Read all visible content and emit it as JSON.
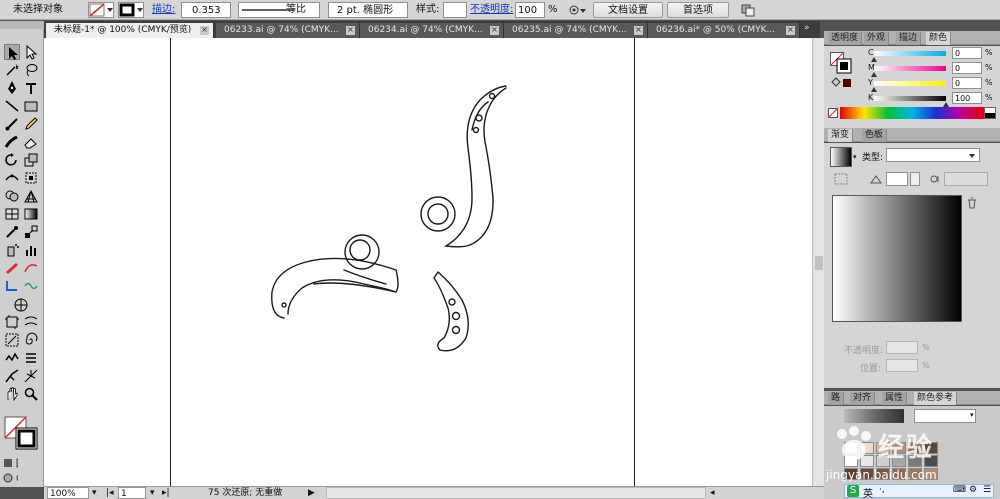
{
  "control_bar": {
    "selection_status": "未选择对象",
    "stroke_label": "描边:",
    "stroke_value": "0.353",
    "profile_label": "等比",
    "brush_label": "2 pt. 椭圆形",
    "style_label": "样式:",
    "opacity_label": "不透明度:",
    "opacity_value": "100",
    "opacity_unit": "%",
    "doc_setup_button": "文档设置",
    "preferences_button": "首选项"
  },
  "tabs": [
    {
      "label": "未标题-1* @ 100% (CMYK/预览)",
      "active": true
    },
    {
      "label": "06233.ai @ 74% (CMYK...",
      "active": false
    },
    {
      "label": "06234.ai @ 74% (CMYK...",
      "active": false
    },
    {
      "label": "06235.ai @ 74% (CMYK...",
      "active": false
    },
    {
      "label": "06236.ai* @ 50% (CMYK...",
      "active": false
    }
  ],
  "status_bar": {
    "zoom": "100%",
    "page": "1",
    "undo_text": "75 次还原; 无重做"
  },
  "color_panel": {
    "tabs": [
      "透明度",
      "外观",
      "描边",
      "颜色"
    ],
    "active_tab": "颜色",
    "channels": [
      {
        "label": "C",
        "value": "0",
        "unit": "%",
        "level": 0
      },
      {
        "label": "M",
        "value": "0",
        "unit": "%",
        "level": 0
      },
      {
        "label": "Y",
        "value": "0",
        "unit": "%",
        "level": 0
      },
      {
        "label": "K",
        "value": "100",
        "unit": "%",
        "level": 1
      }
    ],
    "colors": {
      "c": "#00aeef",
      "m": "#ec008c",
      "y": "#fff200",
      "k": "#000000"
    }
  },
  "gradient_panel": {
    "tabs": [
      "渐变",
      "色板"
    ],
    "active_tab": "渐变",
    "type_label": "类型:",
    "opacity_label": "不透明度:",
    "location_label": "位置:",
    "opacity_unit": "%",
    "location_unit": "%"
  },
  "guide_panel": {
    "tabs": [
      "路",
      "对齐",
      "属性",
      "颜色参考"
    ],
    "active_tab": "颜色参考"
  },
  "watermark": {
    "text": "经验",
    "url": "jingyan.baidu.com"
  },
  "ime": {
    "label": "英"
  },
  "swatch_colors": [
    "#ffffff",
    "#f2d9c9",
    "#d7b7a0",
    "#b08d74",
    "#8c6a52",
    "#5e4636",
    "#ffffff",
    "#e8e8e8",
    "#cfcfcf",
    "#a8a8a8",
    "#7a7a7a",
    "#4c4c4c",
    "#5a3d2a",
    "#6a4a36",
    "#7c5843",
    "#8e6651",
    "#a2775f",
    "#b68a71"
  ]
}
